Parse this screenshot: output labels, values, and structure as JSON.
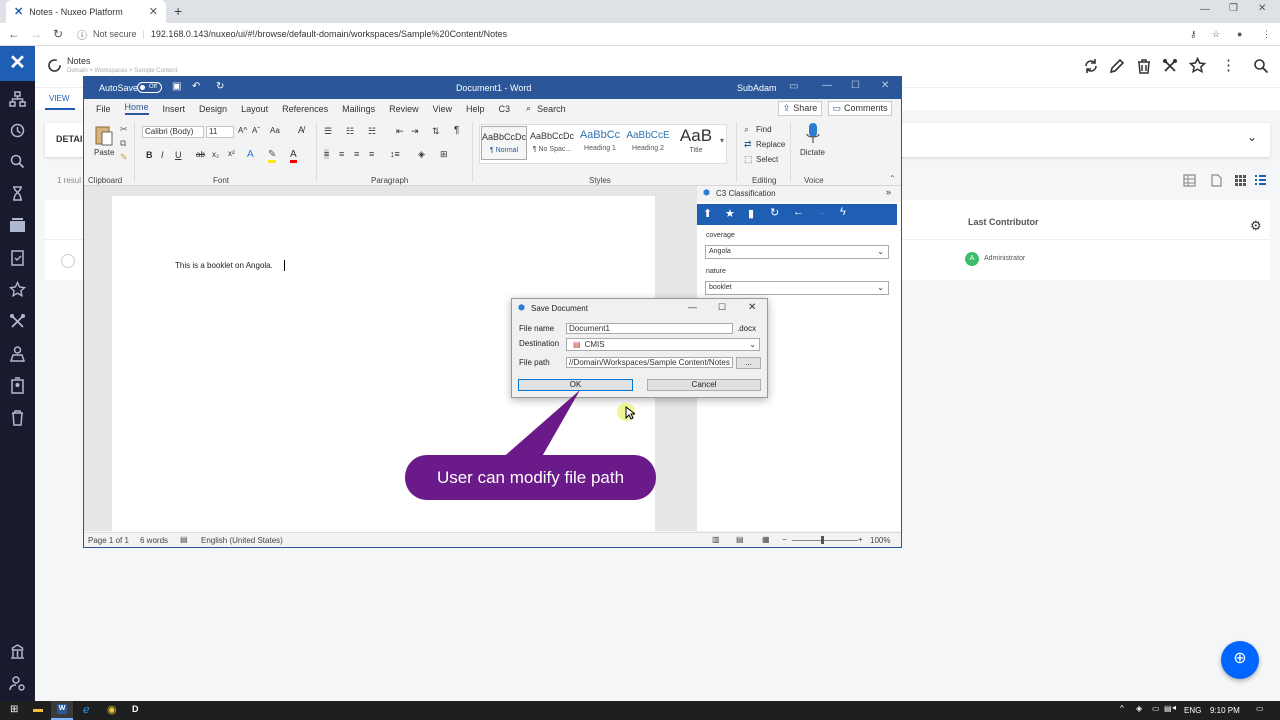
{
  "browser": {
    "tab_title": "Notes - Nuxeo Platform",
    "close_label": "✕",
    "new_tab_label": "+",
    "security_label": "Not secure",
    "url": "192.168.0.143/nuxeo/ui/#!/browse/default-domain/workspaces/Sample%20Content/Notes"
  },
  "nuxeo": {
    "page_title": "Notes",
    "breadcrumb": "Domain > Workspaces > Sample Content",
    "view_tab": "VIEW",
    "details_label": "DETAI",
    "results_label": "1 resul",
    "column_last_contributor": "Last Contributor",
    "contributor_initial": "A",
    "contributor_name": "Administrator"
  },
  "word": {
    "autosave_label": "AutoSave",
    "autosave_state": "Off",
    "title": "Document1 - Word",
    "user": "SubAdam",
    "tabs": [
      "File",
      "Home",
      "Insert",
      "Design",
      "Layout",
      "References",
      "Mailings",
      "Review",
      "View",
      "Help",
      "C3"
    ],
    "search_label": "Search",
    "share_label": "Share",
    "comments_label": "Comments",
    "clipboard": {
      "paste": "Paste",
      "group": "Clipboard"
    },
    "font": {
      "name": "Calibri (Body)",
      "size": "11",
      "group": "Font"
    },
    "paragraph_group": "Paragraph",
    "styles": [
      {
        "preview": "AaBbCcDc",
        "name": "¶ Normal"
      },
      {
        "preview": "AaBbCcDc",
        "name": "¶ No Spac..."
      },
      {
        "preview": "AaBbCc",
        "name": "Heading 1"
      },
      {
        "preview": "AaBbCcE",
        "name": "Heading 2"
      },
      {
        "preview": "AaB",
        "name": "Title"
      }
    ],
    "styles_group": "Styles",
    "editing": {
      "find": "Find",
      "replace": "Replace",
      "select": "Select",
      "group": "Editing"
    },
    "voice": {
      "dictate": "Dictate",
      "group": "Voice"
    },
    "document_text": "This is a booklet on Angola.",
    "status": {
      "page": "Page 1 of 1",
      "words": "6 words",
      "language": "English (United States)",
      "zoom": "100%"
    }
  },
  "c3_panel": {
    "title": "C3 Classification",
    "fields": [
      {
        "label": "coverage",
        "value": "Angola"
      },
      {
        "label": "nature",
        "value": "booklet"
      }
    ]
  },
  "save_dialog": {
    "title": "Save Document",
    "file_name_label": "File name",
    "file_name_value": "Document1",
    "extension": ".docx",
    "destination_label": "Destination",
    "destination_value": "CMIS",
    "file_path_label": "File path",
    "file_path_value": "//Domain/Workspaces/Sample Content/Notes",
    "browse_label": "...",
    "ok_label": "OK",
    "cancel_label": "Cancel"
  },
  "callout_text": "User can modify file path",
  "taskbar": {
    "language": "ENG",
    "time": "9:10 PM"
  },
  "colors": {
    "word_blue": "#2b579a",
    "nuxeo_blue": "#0066ff",
    "c3_blue": "#1e5fb4",
    "callout": "#6b1a8a",
    "sidebar": "#1a1a2e"
  }
}
